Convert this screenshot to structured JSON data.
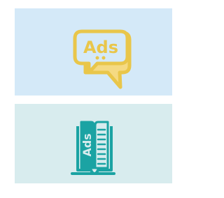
{
  "tiles": [
    {
      "icon": "ads-speech-bubble-icon",
      "label": "Ads",
      "background": "#D4E9F8",
      "color": "#E9C64A"
    },
    {
      "icon": "ads-open-book-icon",
      "label": "Ads",
      "background": "#D8ECEE",
      "color": "#1BA3A3"
    }
  ]
}
